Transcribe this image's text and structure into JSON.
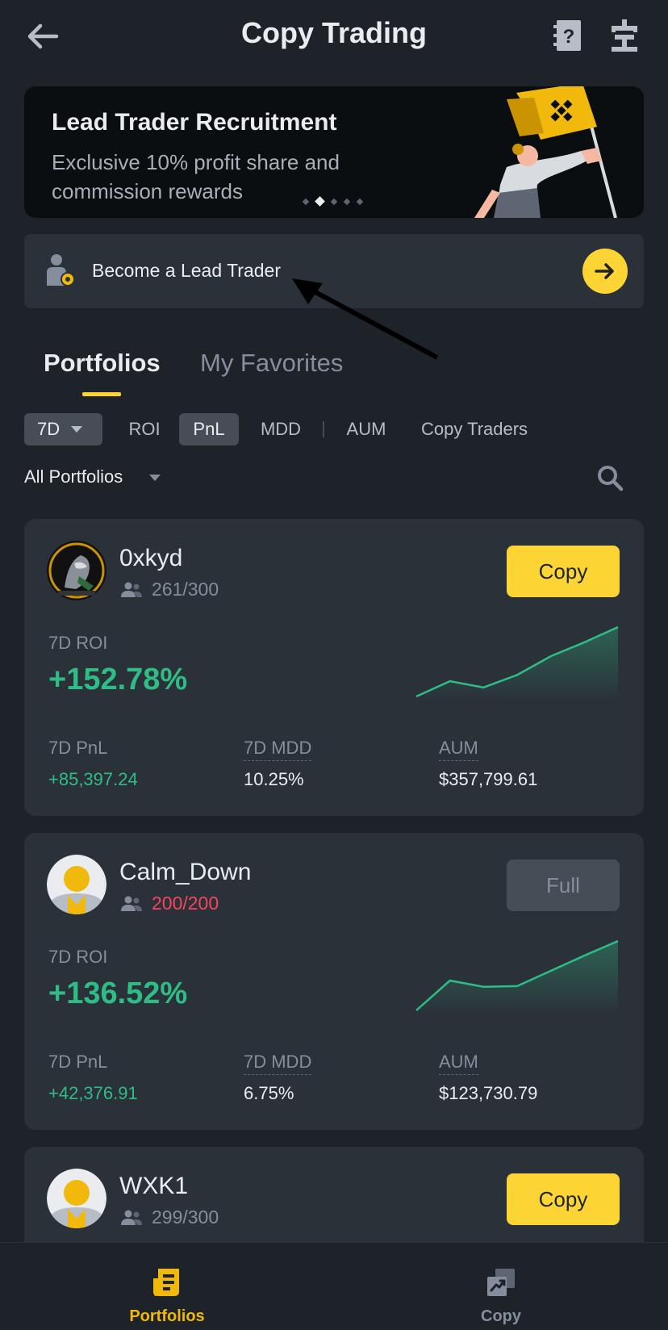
{
  "header": {
    "title": "Copy Trading",
    "icons": [
      "back-arrow-icon",
      "help-book-icon",
      "pin-icon"
    ]
  },
  "banner": {
    "title": "Lead Trader Recruitment",
    "subtitle": "Exclusive 10% profit share and commission rewards",
    "slide_count": 5,
    "active_slide": 2
  },
  "lead_trader": {
    "label": "Become a Lead Trader"
  },
  "tabs": [
    {
      "label": "Portfolios",
      "active": true
    },
    {
      "label": "My Favorites",
      "active": false
    }
  ],
  "filters": {
    "period": "7D",
    "sort_options": [
      "ROI",
      "PnL",
      "MDD",
      "AUM",
      "Copy Traders"
    ],
    "active_sort": "PnL"
  },
  "portfolio_filter": "All Portfolios",
  "traders": [
    {
      "name": "0xkyd",
      "followers": "261/300",
      "button": "Copy",
      "roi_label": "7D ROI",
      "roi": "+152.78%",
      "pnl_label": "7D PnL",
      "pnl": "+85,397.24",
      "mdd_label": "7D MDD",
      "mdd": "10.25%",
      "aum_label": "AUM",
      "aum": "$357,799.61",
      "trend": [
        0.0,
        0.22,
        0.13,
        0.31,
        0.58,
        0.78,
        1.0
      ]
    },
    {
      "name": "Calm_Down",
      "followers": "200/200",
      "button": "Full",
      "roi_label": "7D ROI",
      "roi": "+136.52%",
      "pnl_label": "7D PnL",
      "pnl": "+42,376.91",
      "mdd_label": "7D MDD",
      "mdd": "6.75%",
      "aum_label": "AUM",
      "aum": "$123,730.79",
      "trend": [
        0.0,
        0.43,
        0.34,
        0.35,
        0.57,
        0.79,
        1.0
      ]
    },
    {
      "name": "WXK1",
      "followers": "299/300",
      "button": "Copy"
    }
  ],
  "bottom_nav": [
    {
      "label": "Portfolios",
      "icon": "portfolios-icon",
      "active": true
    },
    {
      "label": "Copy",
      "icon": "copy-icon",
      "active": false
    }
  ],
  "colors": {
    "accent": "#fcd535",
    "positive": "#2ebd85",
    "negative": "#f6465d",
    "background": "#1e2329",
    "card": "#2b3139"
  }
}
